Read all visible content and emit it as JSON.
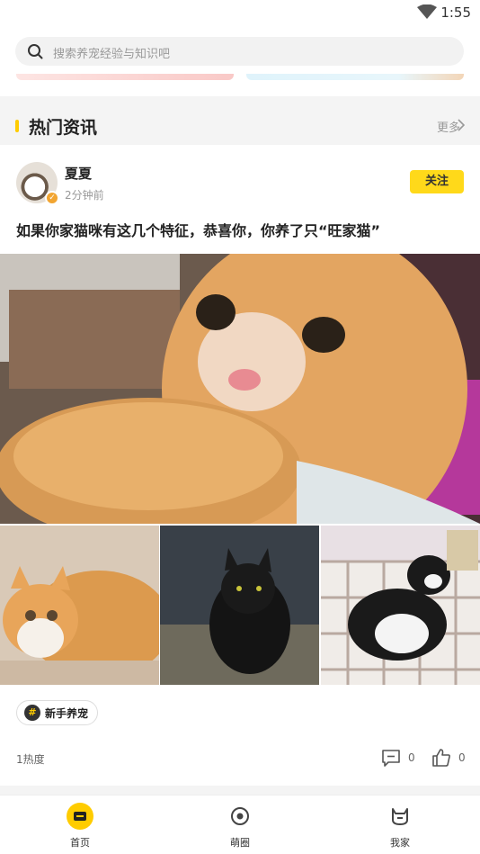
{
  "status_bar": {
    "time": "1:55"
  },
  "search": {
    "placeholder": "搜索养宠经验与知识吧"
  },
  "section": {
    "title": "热门资讯",
    "more_label": "更多"
  },
  "post": {
    "author": "夏夏",
    "time_ago": "2分钟前",
    "follow_label": "关注",
    "title": "如果你家猫咪有这几个特征，恭喜你，你养了只“旺家猫”",
    "tag": "新手养宠",
    "heat": "1热度",
    "comments": "0",
    "likes": "0"
  },
  "nav": {
    "items": [
      {
        "label": "首页",
        "icon": "home-icon",
        "active": true
      },
      {
        "label": "萌圈",
        "icon": "circle-icon",
        "active": false
      },
      {
        "label": "我家",
        "icon": "cat-face-icon",
        "active": false
      }
    ]
  },
  "colors": {
    "accent": "#ffcc00",
    "follow_bg": "#ffd91a",
    "verify_badge": "#f2a531"
  }
}
